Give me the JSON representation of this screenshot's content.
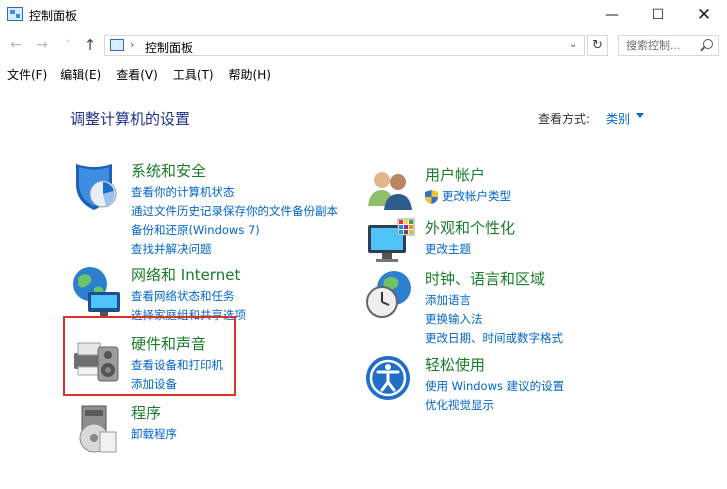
{
  "window": {
    "title": "控制面板",
    "minimize": "—",
    "maximize": "☐",
    "close": "✕"
  },
  "nav": {
    "back": "←",
    "forward": "→",
    "recent": "˅",
    "up": "↑",
    "breadcrumb_sep": "›",
    "breadcrumb": "控制面板",
    "dropdown": "⌄",
    "refresh": "↻",
    "search_placeholder": "搜索控制..."
  },
  "menu": [
    "文件(F)",
    "编辑(E)",
    "查看(V)",
    "工具(T)",
    "帮助(H)"
  ],
  "page": {
    "title": "调整计算机的设置",
    "view_by_label": "查看方式:",
    "view_by_value": "类别"
  },
  "categories": {
    "system_security": {
      "title": "系统和安全",
      "links": [
        "查看你的计算机状态",
        "通过文件历史记录保存你的文件备份副本",
        "备份和还原(Windows 7)",
        "查找并解决问题"
      ]
    },
    "network": {
      "title": "网络和 Internet",
      "links": [
        "查看网络状态和任务",
        "选择家庭组和共享选项"
      ]
    },
    "hardware_sound": {
      "title": "硬件和声音",
      "links": [
        "查看设备和打印机",
        "添加设备"
      ]
    },
    "programs": {
      "title": "程序",
      "links": [
        "卸载程序"
      ]
    },
    "user_accounts": {
      "title": "用户帐户",
      "links": [
        "更改帐户类型"
      ]
    },
    "appearance": {
      "title": "外观和个性化",
      "links": [
        "更改主题"
      ]
    },
    "clock_region": {
      "title": "时钟、语言和区域",
      "links": [
        "添加语言",
        "更换输入法",
        "更改日期、时间或数字格式"
      ]
    },
    "ease_access": {
      "title": "轻松使用",
      "links": [
        "使用 Windows 建议的设置",
        "优化视觉显示"
      ]
    }
  }
}
